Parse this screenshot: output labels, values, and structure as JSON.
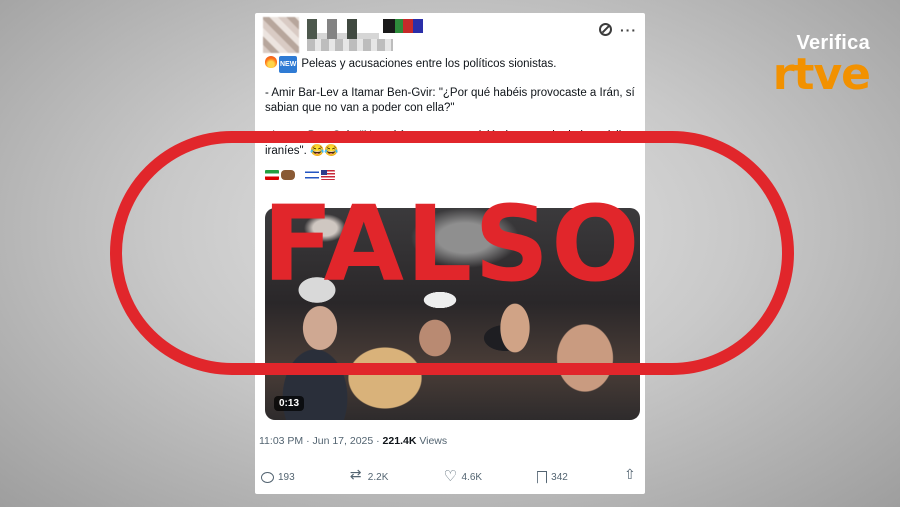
{
  "brand": {
    "top": "Verifica",
    "logo": "rtve"
  },
  "post": {
    "headline": "Peleas y acusaciones entre los políticos sionistas.",
    "headline_badge": "NEW",
    "lines": [
      "- Amir Bar-Lev a Itamar Ben-Gvir: \"¿Por qué habéis provocaste a Irán, sí",
      "sabian que no van a poder con ella?\"",
      "- Itamar Ben-Gvir: \"No sabíamos con precisión la potencia de los misiles",
      "iraníes\". 😂😂"
    ],
    "video_duration": "0:13",
    "timestamp": "11:03 PM · Jun 17, 2025 · ",
    "views_count": "221.4K",
    "views_label": " Views",
    "actions": {
      "replies": "193",
      "reposts": "2.2K",
      "likes": "4.6K",
      "bookmarks": "342"
    }
  },
  "stamp": {
    "label": "FALSO",
    "color": "#e1262b"
  },
  "colors": {
    "brand_orange": "#f29100",
    "muted": "#536471"
  }
}
